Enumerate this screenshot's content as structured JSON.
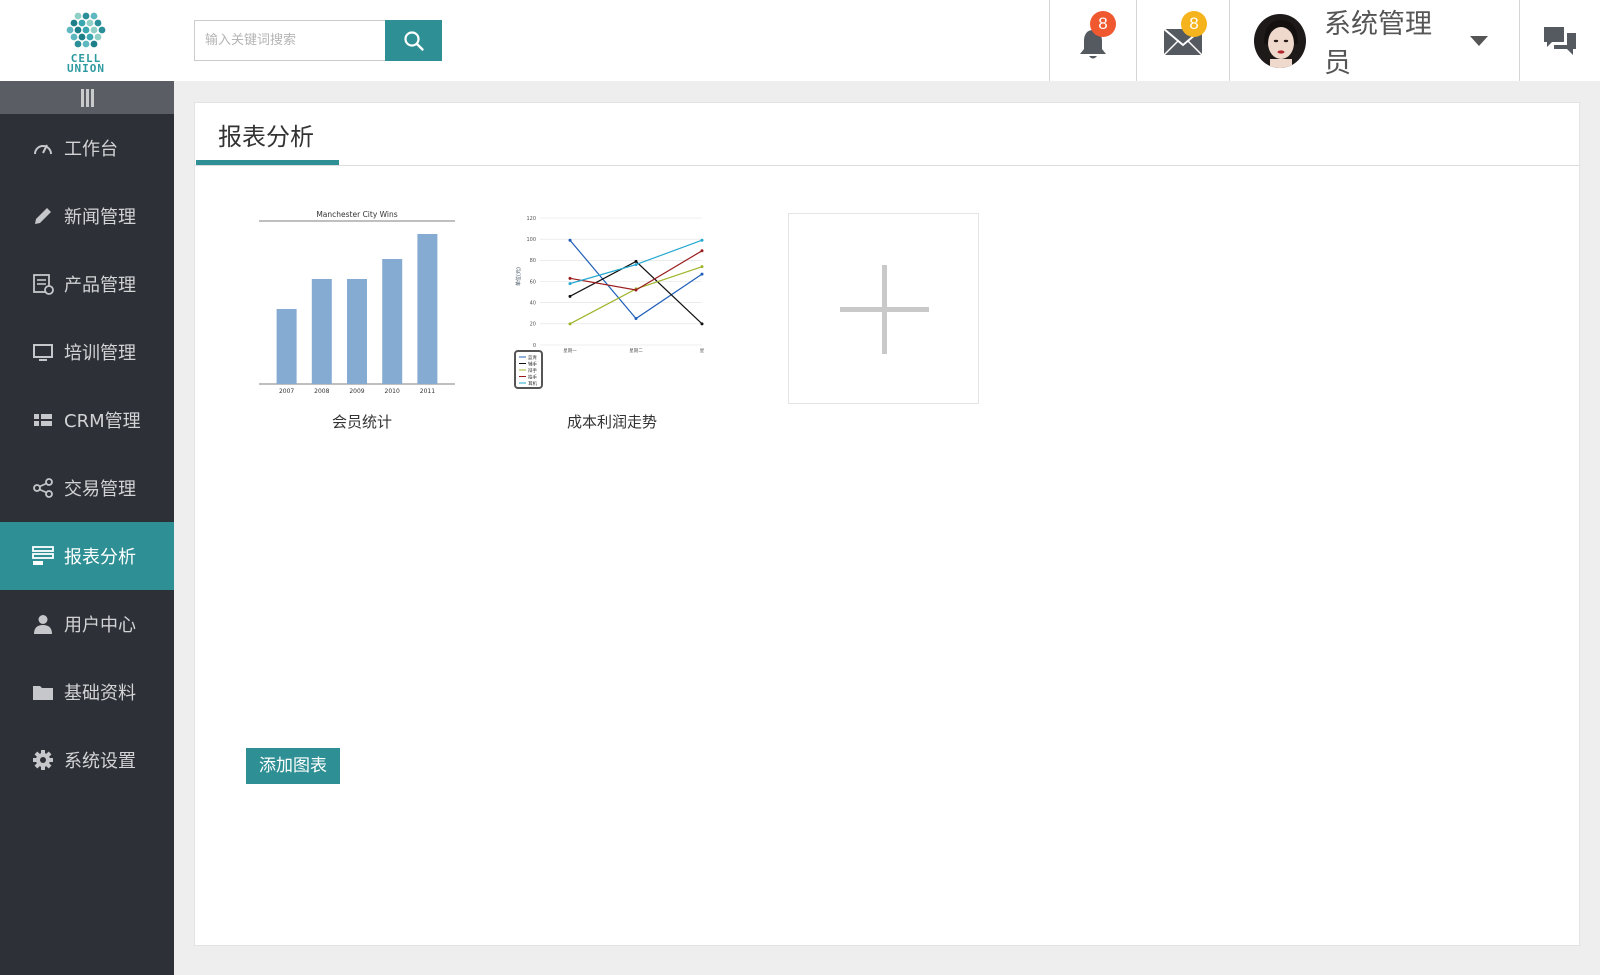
{
  "header": {
    "logo_text_line1": "CELL",
    "logo_text_line2": "UNION",
    "search_placeholder": "输入关键词搜索",
    "notifications_count": "8",
    "messages_count": "8",
    "user_name": "系统管理员",
    "colors": {
      "accent": "#2e8f94",
      "notif_badge": "#f0582f",
      "msg_badge": "#f5b41d"
    }
  },
  "sidebar": {
    "items": [
      {
        "label": "工作台",
        "icon": "speedometer-icon"
      },
      {
        "label": "新闻管理",
        "icon": "pencil-icon"
      },
      {
        "label": "产品管理",
        "icon": "list-settings-icon"
      },
      {
        "label": "培训管理",
        "icon": "monitor-icon"
      },
      {
        "label": "CRM管理",
        "icon": "grid-icon"
      },
      {
        "label": "交易管理",
        "icon": "share-icon"
      },
      {
        "label": "报表分析",
        "icon": "report-icon",
        "active": true
      },
      {
        "label": "用户中心",
        "icon": "user-icon"
      },
      {
        "label": "基础资料",
        "icon": "folder-icon"
      },
      {
        "label": "系统设置",
        "icon": "gear-icon"
      }
    ]
  },
  "main": {
    "title": "报表分析",
    "add_chart_label": "添加图表",
    "cards": [
      {
        "caption": "会员统计"
      },
      {
        "caption": "成本利润走势"
      }
    ]
  },
  "chart_data": [
    {
      "type": "bar",
      "title": "Manchester City Wins",
      "categories": [
        "2007",
        "2008",
        "2009",
        "2010",
        "2011"
      ],
      "values": [
        15,
        21,
        21,
        25,
        30
      ],
      "ylim": [
        0,
        32
      ],
      "color": "#86abd2"
    },
    {
      "type": "line",
      "categories": [
        "星期一",
        "星期二",
        "星"
      ],
      "ylim": [
        0,
        120
      ],
      "yticks": [
        0,
        20,
        40,
        60,
        80,
        100,
        120
      ],
      "legend_lines": [
        "蓝青",
        "辅手",
        "辩手",
        "拍手",
        "耳机"
      ],
      "series": [
        {
          "color": "#1f5fb8",
          "values": [
            99,
            25,
            67
          ]
        },
        {
          "color": "#111111",
          "values": [
            46,
            79,
            20
          ]
        },
        {
          "color": "#9fb42a",
          "values": [
            20,
            53,
            74
          ]
        },
        {
          "color": "#9b1c1c",
          "values": [
            63,
            52,
            89
          ]
        },
        {
          "color": "#25a8d0",
          "values": [
            58,
            76,
            99
          ]
        }
      ]
    }
  ]
}
